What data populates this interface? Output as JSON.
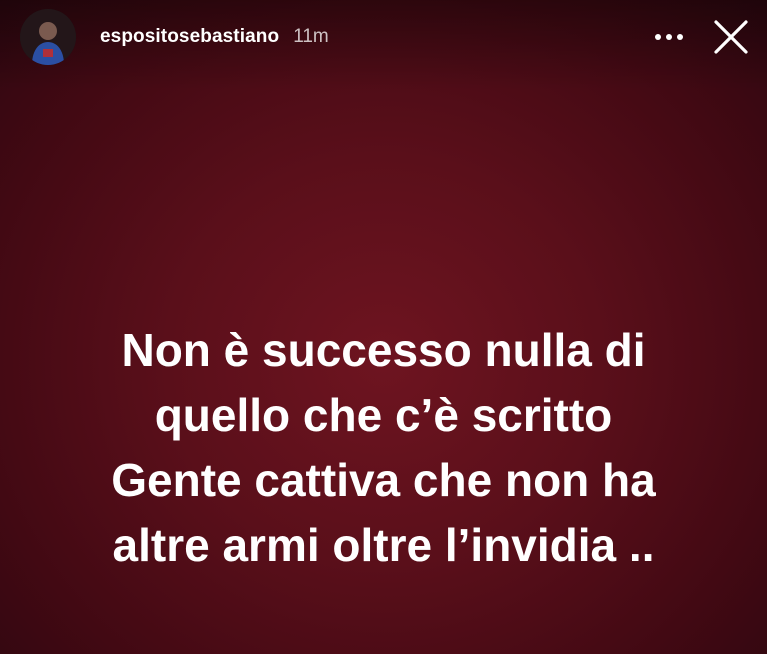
{
  "header": {
    "username": "espositosebastiano",
    "time": "11m",
    "icons": {
      "avatar": "profile-avatar",
      "more": "more-options-icon",
      "close": "close-icon"
    }
  },
  "story": {
    "lines": [
      "Non è successo nulla di",
      "quello che c’è scritto",
      "Gente cattiva che non ha",
      "altre armi oltre l’invidia .."
    ]
  },
  "colors": {
    "background": "#5a0f1a",
    "text": "#ffffff"
  }
}
